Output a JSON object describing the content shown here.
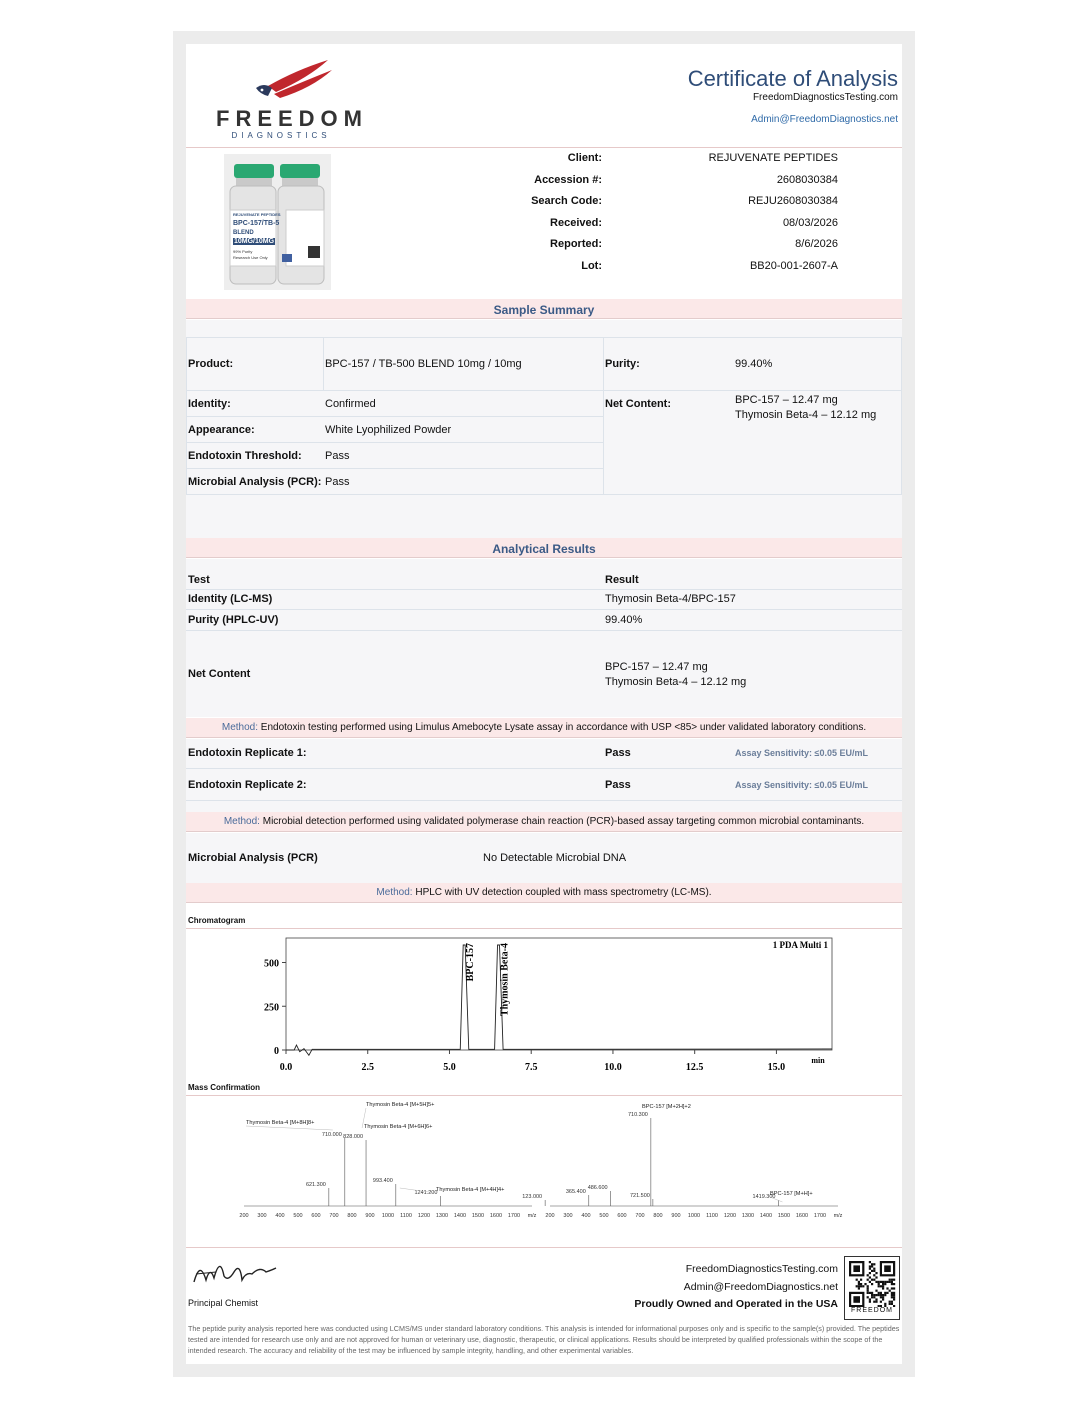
{
  "header": {
    "logo_word": "FREEDOM",
    "logo_sub": "DIAGNOSTICS",
    "title": "Certificate of Analysis",
    "website": "FreedomDiagnosticsTesting.com",
    "email": "Admin@FreedomDiagnostics.net"
  },
  "vial": {
    "label_lines": [
      "REJUVENATE PEPTIDES",
      "BPC-157/TB-5",
      "BLEND",
      "10MG/10MG",
      "99% Purity",
      "Research Use Only"
    ]
  },
  "client_info": [
    {
      "label": "Client:",
      "value": "REJUVENATE PEPTIDES"
    },
    {
      "label": "Accession #:",
      "value": "2608030384"
    },
    {
      "label": "Search Code:",
      "value": "REJU2608030384"
    },
    {
      "label": "Received:",
      "value": "08/03/2026"
    },
    {
      "label": "Reported:",
      "value": "8/6/2026"
    },
    {
      "label": "Lot:",
      "value": "BB20-001-2607-A"
    }
  ],
  "sample_summary": {
    "title": "Sample Summary",
    "product_label": "Product:",
    "product_value": "BPC-157 / TB-500 BLEND 10mg / 10mg",
    "purity_label": "Purity:",
    "purity_value": "99.40%",
    "net_label": "Net Content:",
    "net_lines": [
      "BPC-157 – 12.47 mg",
      "Thymosin Beta-4 – 12.12 mg"
    ],
    "rows": [
      {
        "label": "Identity:",
        "value": "Confirmed"
      },
      {
        "label": "Appearance:",
        "value": "White Lyophilized Powder"
      },
      {
        "label": "Endotoxin Threshold:",
        "value": "Pass"
      },
      {
        "label": "Microbial Analysis (PCR):",
        "value": "Pass"
      }
    ]
  },
  "analytical": {
    "title": "Analytical Results",
    "col_test": "Test",
    "col_result": "Result",
    "rows": [
      {
        "test": "Identity (LC-MS)",
        "result": "Thymosin Beta-4/BPC-157"
      },
      {
        "test": "Purity (HPLC-UV)",
        "result": "99.40%"
      }
    ],
    "net_label": "Net Content",
    "net_lines": [
      "BPC-157 – 12.47 mg",
      "Thymosin Beta-4 – 12.12 mg"
    ],
    "method_key": "Method:",
    "method1": " Endotoxin testing performed using Limulus Amebocyte Lysate assay in accordance with USP <85> under validated laboratory conditions.",
    "endotoxin": [
      {
        "label": "Endotoxin Replicate 1:",
        "result": "Pass",
        "note": "Assay Sensitivity: ≤0.05 EU/mL"
      },
      {
        "label": "Endotoxin Replicate 2:",
        "result": "Pass",
        "note": "Assay Sensitivity: ≤0.05 EU/mL"
      }
    ],
    "method2": " Microbial detection performed using validated polymerase chain reaction (PCR)-based assay targeting common microbial contaminants.",
    "microbial_label": "Microbial Analysis (PCR)",
    "microbial_value": "No Detectable Microbial DNA",
    "method3": " HPLC with UV detection coupled with mass spectrometry (LC-MS)."
  },
  "chromatogram": {
    "section_label": "Chromatogram",
    "legend": "1 PDA Multi 1",
    "x_unit": "min",
    "x_ticks": [
      "0.0",
      "2.5",
      "5.0",
      "7.5",
      "10.0",
      "12.5",
      "15.0"
    ],
    "y_ticks": [
      "0",
      "250",
      "500"
    ],
    "peaks": [
      {
        "name": "BPC-157",
        "rt": 5.45,
        "height": 600
      },
      {
        "name": "Thymosin Beta-4",
        "rt": 6.5,
        "height": 600
      }
    ]
  },
  "mass": {
    "section_label": "Mass Confirmation",
    "left_ticks": [
      "200",
      "300",
      "400",
      "500",
      "600",
      "700",
      "800",
      "900",
      "1000",
      "1100",
      "1200",
      "1300",
      "1400",
      "1500",
      "1600",
      "1700",
      "m/z"
    ],
    "right_ticks": [
      "200",
      "300",
      "400",
      "500",
      "600",
      "700",
      "800",
      "900",
      "1000",
      "1100",
      "1200",
      "1300",
      "1400",
      "1500",
      "1600",
      "1700",
      "m/z"
    ],
    "left_peaks": [
      {
        "mz": 621.3,
        "label": "621.300",
        "h": 0.18
      },
      {
        "mz": 710.0,
        "label": "710.000",
        "h": 0.68
      },
      {
        "mz": 828.0,
        "label": "828.000",
        "h": 0.66
      },
      {
        "mz": 993.4,
        "label": "993.400",
        "h": 0.22
      },
      {
        "mz": 1241.2,
        "label": "1241.200",
        "h": 0.1
      }
    ],
    "left_annotations": [
      "Thymosin Beta-4 [M+8H]8+",
      "Thymosin Beta-4 [M+5H]5+",
      "Thymosin Beta-4 [M+6H]6+",
      "Thymosin Beta-4 [M+4H]4+"
    ],
    "right_peaks": [
      {
        "mz": 123.0,
        "label": "123.000",
        "h": 0.06
      },
      {
        "mz": 365.4,
        "label": "365.400",
        "h": 0.11
      },
      {
        "mz": 486.6,
        "label": "486.600",
        "h": 0.15
      },
      {
        "mz": 710.3,
        "label": "710.300",
        "h": 0.88
      },
      {
        "mz": 721.5,
        "label": "721.500",
        "h": 0.07
      },
      {
        "mz": 1419.3,
        "label": "1419.300",
        "h": 0.06
      }
    ],
    "right_annotations": [
      "BPC-157 [M+2H]+2",
      "BPC-157 [M+H]+"
    ]
  },
  "footer": {
    "signature": "Alex Johnson",
    "signer_title": "Principal Chemist",
    "website": "FreedomDiagnosticsTesting.com",
    "email": "Admin@FreedomDiagnostics.net",
    "tagline": "Proudly Owned and Operated in the USA",
    "qr_label": "FREEDOM",
    "disclaimer": "The peptide purity analysis reported here was conducted using LCMS/MS under standard laboratory conditions. This analysis is intended for informational purposes only and is specific to the sample(s) provided. The peptides tested are intended for research use only and are not approved for human or veterinary use, diagnostic, therapeutic, or clinical applications. Results should be interpreted by qualified professionals within the scope of the intended research. The accuracy and reliability of the test may be influenced by sample integrity, handling, and other experimental variables."
  },
  "colors": {
    "title_blue": "#2f4d78",
    "band_pink": "#fbe8e8",
    "logo_red": "#c0272d",
    "logo_navy": "#2b3a5c"
  }
}
